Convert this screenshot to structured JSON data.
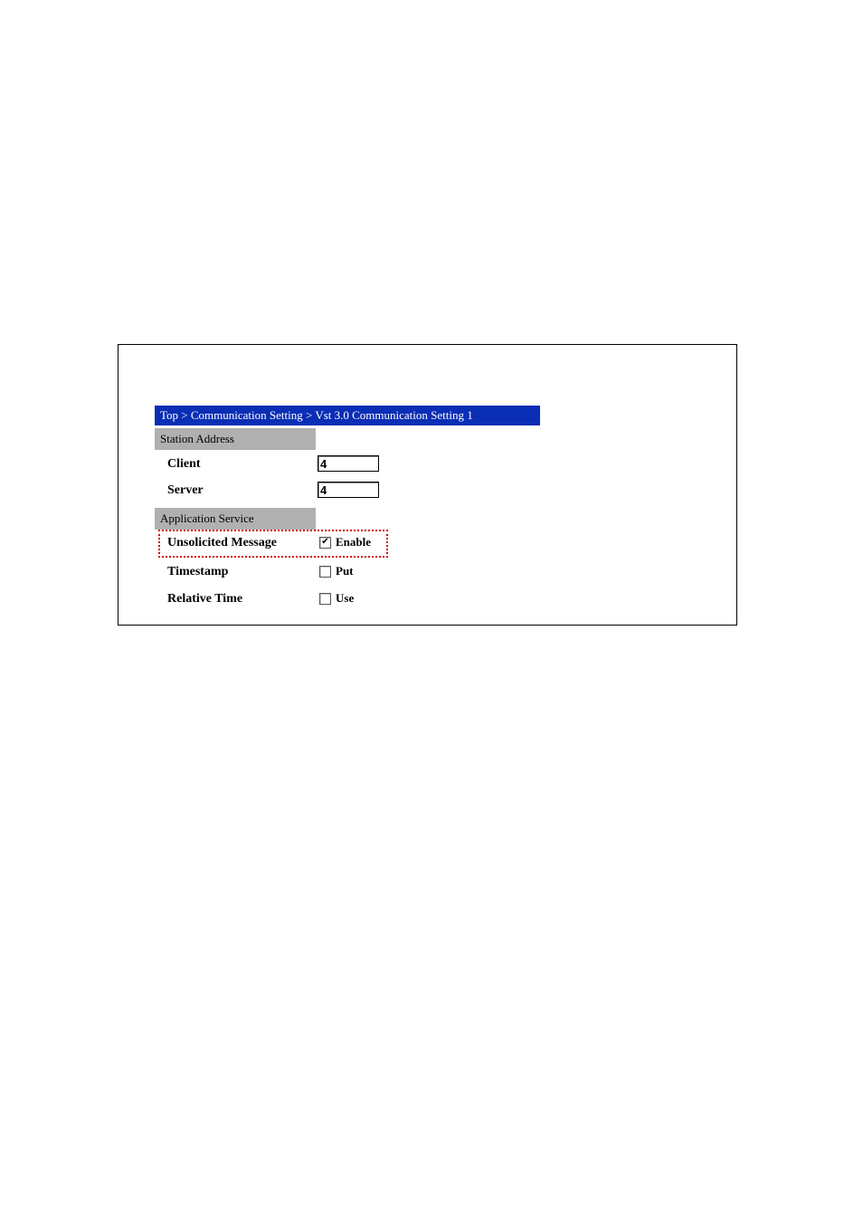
{
  "breadcrumb": "Top > Communication Setting > Vst 3.0 Communication Setting 1",
  "sections": {
    "station_address": "Station Address",
    "application_service": "Application Service"
  },
  "labels": {
    "client": "Client",
    "server": "Server",
    "unsolicited": "Unsolicited Message",
    "timestamp": "Timestamp",
    "relative_time": "Relative Time"
  },
  "values": {
    "client": "4",
    "server": "4"
  },
  "checkboxes": {
    "enable": {
      "label": "Enable",
      "checked": true
    },
    "put": {
      "label": "Put",
      "checked": false
    },
    "use": {
      "label": "Use",
      "checked": false
    }
  }
}
